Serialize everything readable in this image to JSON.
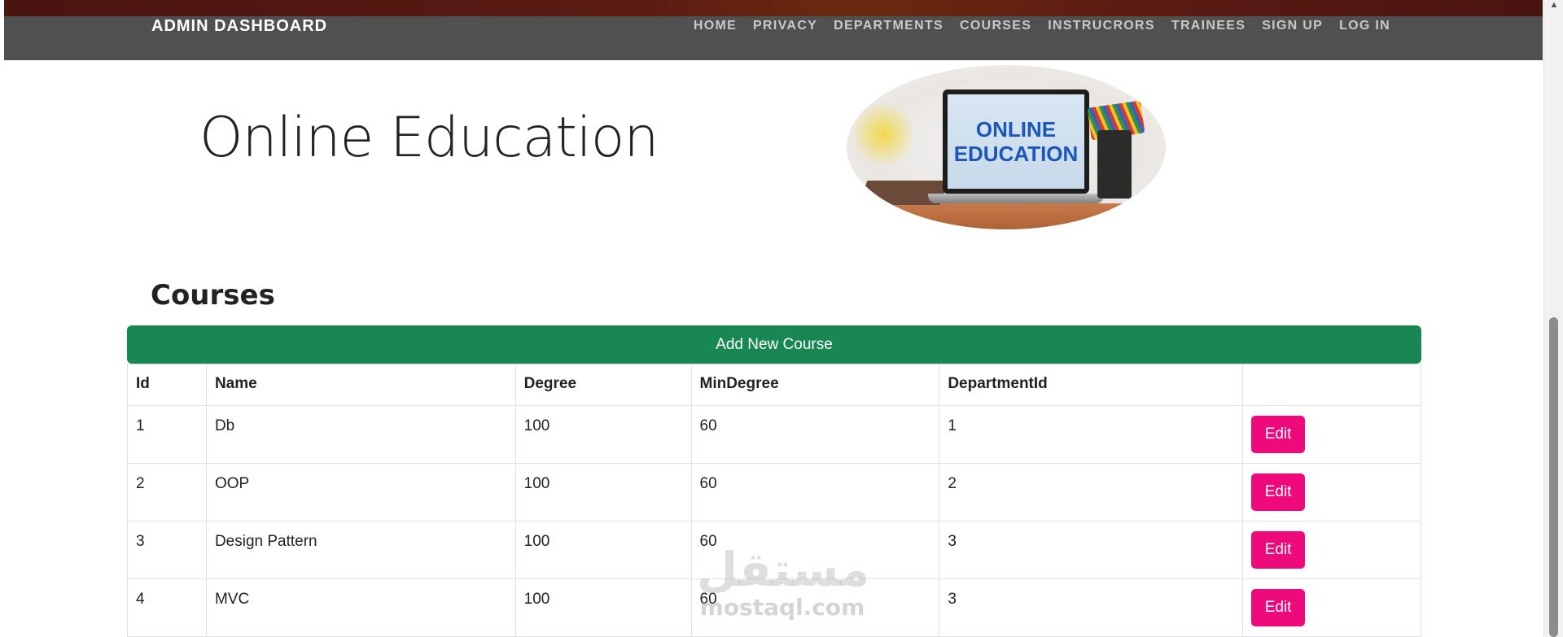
{
  "navbar": {
    "brand": "ADMIN DASHBOARD",
    "links": [
      "HOME",
      "PRIVACY",
      "DEPARTMENTS",
      "COURSES",
      "INSTRUCRORS",
      "TRAINEES",
      "SIGN UP",
      "LOG IN"
    ]
  },
  "hero": {
    "title": "Online Education",
    "image_text_line1": "ONLINE",
    "image_text_line2": "EDUCATION"
  },
  "courses": {
    "heading": "Courses",
    "add_button_label": "Add New Course",
    "columns": [
      "Id",
      "Name",
      "Degree",
      "MinDegree",
      "DepartmentId",
      ""
    ],
    "rows": [
      {
        "id": "1",
        "name": "Db",
        "degree": "100",
        "min_degree": "60",
        "department_id": "1",
        "action": "Edit"
      },
      {
        "id": "2",
        "name": "OOP",
        "degree": "100",
        "min_degree": "60",
        "department_id": "2",
        "action": "Edit"
      },
      {
        "id": "3",
        "name": "Design Pattern",
        "degree": "100",
        "min_degree": "60",
        "department_id": "3",
        "action": "Edit"
      },
      {
        "id": "4",
        "name": "MVC",
        "degree": "100",
        "min_degree": "60",
        "department_id": "3",
        "action": "Edit"
      }
    ]
  },
  "watermark": {
    "arabic": "مستقل",
    "latin": "mostaql.com"
  },
  "colors": {
    "navbar_bg": "#505050",
    "add_button": "#198754",
    "edit_button": "#ee0a7a"
  },
  "icons": {
    "scroll_up": "scroll-up-arrow-icon"
  }
}
